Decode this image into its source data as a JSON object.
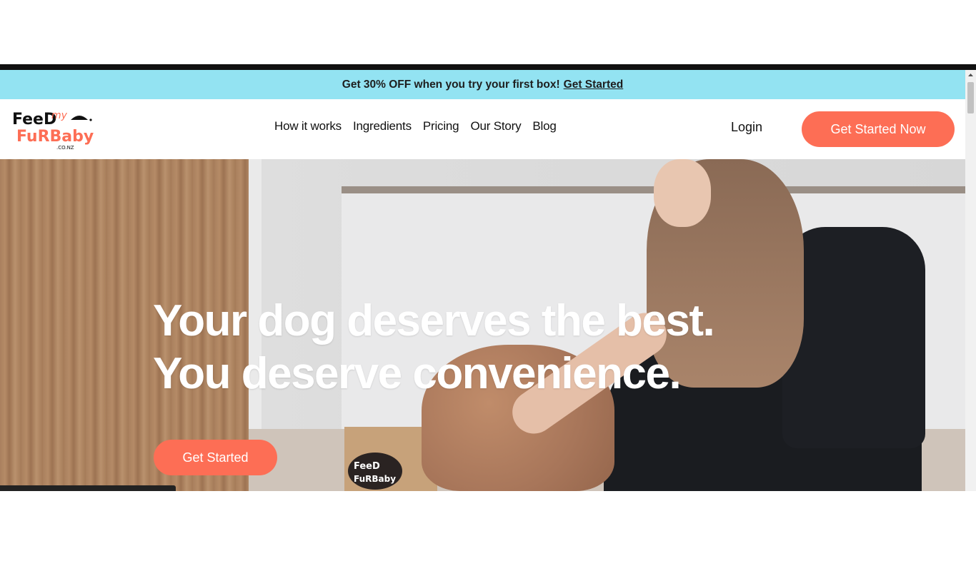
{
  "promo": {
    "text": "Get 30% OFF when you try your first box!",
    "link": "Get Started"
  },
  "brand": {
    "logo_line1": "FeeD",
    "logo_my": "my",
    "logo_line2": "FuRBaby",
    "logo_tld": ".CO.NZ"
  },
  "nav": {
    "links": [
      "How it works",
      "Ingredients",
      "Pricing",
      "Our Story",
      "Blog"
    ],
    "login": "Login",
    "cta": "Get Started Now"
  },
  "hero": {
    "headline_line1": "Your dog deserves the best.",
    "headline_line2": "You deserve convenience.",
    "cta": "Get Started"
  },
  "box_logo": {
    "line1": "FeeD",
    "line2": "FuRBaby"
  },
  "colors": {
    "accent": "#fd6e55",
    "promo_bg": "#93e3f2"
  },
  "icons": {
    "chat": "chat-bubble-icon",
    "logo_bowl": "dog-bowl-icon"
  }
}
